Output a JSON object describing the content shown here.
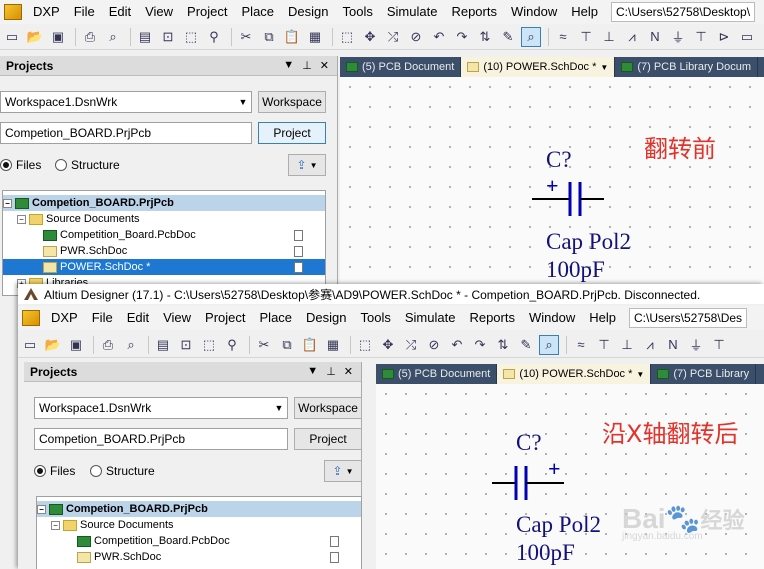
{
  "window_back": {
    "menu": {
      "app_label": "DXP",
      "items": [
        "File",
        "Edit",
        "View",
        "Project",
        "Place",
        "Design",
        "Tools",
        "Simulate",
        "Reports",
        "Window",
        "Help"
      ],
      "path": "C:\\Users\\52758\\Desktop\\"
    },
    "panel": {
      "title": "Projects",
      "workspace_value": "Workspace1.DsnWrk",
      "workspace_btn": "Workspace",
      "project_value": "Competion_BOARD.PrjPcb",
      "project_btn": "Project",
      "files_label": "Files",
      "structure_label": "Structure",
      "tree": {
        "root": "Competion_BOARD.PrjPcb",
        "folder": "Source Documents",
        "items": [
          "Competition_Board.PcbDoc",
          "PWR.SchDoc",
          "POWER.SchDoc *"
        ],
        "libraries": "Libraries"
      }
    },
    "tabs": [
      "(5) PCB Document",
      "(10) POWER.SchDoc *",
      "(7) PCB Library Docum"
    ],
    "annotation": "翻转前",
    "component": {
      "designator": "C?",
      "comment": "Cap Pol2",
      "value": "100pF",
      "polarity": "+"
    }
  },
  "window_front": {
    "title": "Altium Designer (17.1) - C:\\Users\\52758\\Desktop\\参赛\\AD9\\POWER.SchDoc * - Competion_BOARD.PrjPcb. Disconnected.",
    "menu": {
      "app_label": "DXP",
      "items": [
        "File",
        "Edit",
        "View",
        "Project",
        "Place",
        "Design",
        "Tools",
        "Simulate",
        "Reports",
        "Window",
        "Help"
      ],
      "path": "C:\\Users\\52758\\Des"
    },
    "panel": {
      "title": "Projects",
      "workspace_value": "Workspace1.DsnWrk",
      "workspace_btn": "Workspace",
      "project_value": "Competion_BOARD.PrjPcb",
      "project_btn": "Project",
      "files_label": "Files",
      "structure_label": "Structure",
      "tree": {
        "root": "Competion_BOARD.PrjPcb",
        "folder": "Source Documents",
        "items": [
          "Competition_Board.PcbDoc",
          "PWR.SchDoc"
        ]
      }
    },
    "tabs": [
      "(5) PCB Document",
      "(10) POWER.SchDoc *",
      "(7) PCB Library"
    ],
    "annotation": "沿X轴翻转后",
    "component": {
      "designator": "C?",
      "comment": "Cap Pol2",
      "value": "100pF",
      "polarity": "+"
    }
  },
  "watermark": {
    "text": "Bai",
    "sub": "经验",
    "url": "jingyan.baidu.com"
  },
  "colors": {
    "annotation": "#e0332b",
    "component": "#12127a",
    "wire": "#0000b4",
    "selection": "#1e78d2",
    "doc_tab_bar": "#3b4f6a"
  }
}
